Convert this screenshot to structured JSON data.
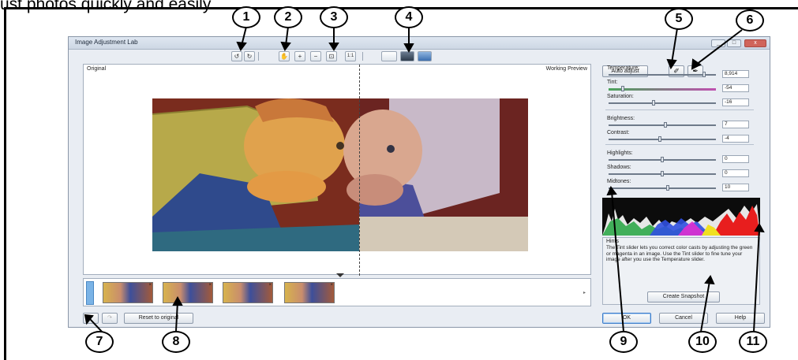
{
  "caption": "ust photos quickly and easily.",
  "window": {
    "title": "Image Adjustment Lab",
    "controls": [
      "_",
      "□",
      "x"
    ]
  },
  "toolbar": {
    "undo_icon": "↺",
    "redo_icon": "↻",
    "pan_icon": "✋",
    "zoom_in_icon": "+",
    "zoom_out_icon": "−",
    "fit_icon": "⊡",
    "actual_size_icon": "1:1"
  },
  "preview": {
    "original_label": "Original",
    "working_label": "Working Preview"
  },
  "panel": {
    "auto_adjust": "Auto adjust",
    "white_point_icon": "eyedropper-white",
    "black_point_icon": "eyedropper-black",
    "controls": [
      {
        "label": "Temperature:",
        "value": "8,914",
        "level": 0.9
      },
      {
        "label": "Tint:",
        "value": "-54",
        "level": 0.12
      },
      {
        "label": "Saturation:",
        "value": "-16",
        "level": 0.42
      },
      {
        "label": "Brightness:",
        "value": "7",
        "level": 0.53
      },
      {
        "label": "Contrast:",
        "value": "-4",
        "level": 0.48
      },
      {
        "label": "Highlights:",
        "value": "0",
        "level": 0.5
      },
      {
        "label": "Shadows:",
        "value": "0",
        "level": 0.5
      },
      {
        "label": "Midtones:",
        "value": "10",
        "level": 0.55
      }
    ],
    "hints_title": "Hints",
    "hints_text": "The Tint slider lets you correct color casts by adjusting the green or magenta in an image. Use the Tint slider to fine tune your image after you use the Temperature slider.",
    "create_snapshot": "Create Snapshot"
  },
  "bottom": {
    "undo_icon": "↶",
    "redo_icon": "↷",
    "reset_to_original": "Reset to original",
    "ok": "OK",
    "cancel": "Cancel",
    "help": "Help"
  },
  "snapshot_close": "×",
  "callouts": [
    "1",
    "2",
    "3",
    "4",
    "5",
    "6",
    "7",
    "8",
    "9",
    "10",
    "11"
  ]
}
